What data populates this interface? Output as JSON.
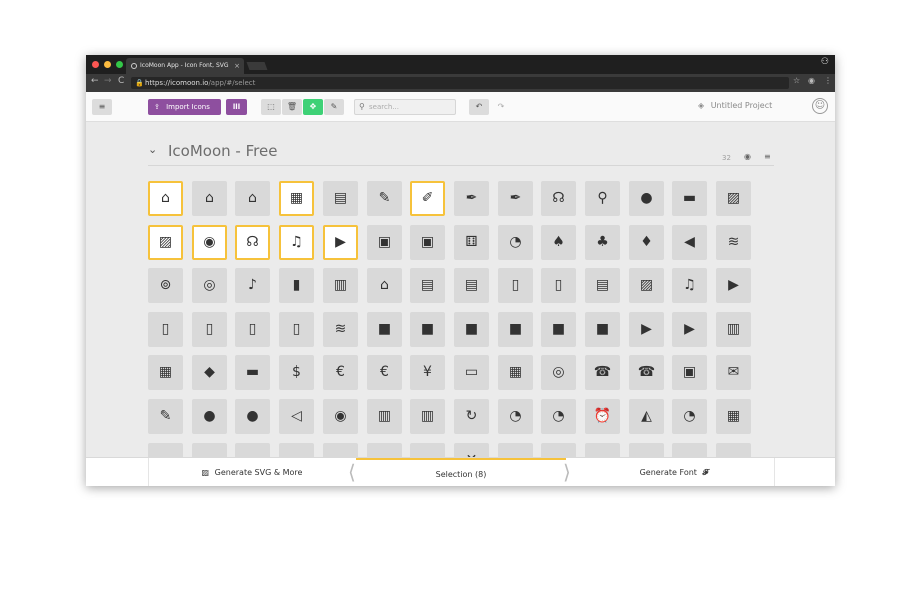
{
  "browser": {
    "tab_title": "IcoMoon App - Icon Font, SVG",
    "tab_close": "×",
    "url_host": "https://icomoon.io",
    "url_path": "/app/#/select",
    "back": "←",
    "forward": "→",
    "reload": "C"
  },
  "toolbar": {
    "menu_icon": "≡",
    "import_label": "Import Icons",
    "import_icon": "⇪",
    "library_icon": "lll",
    "select_icon": "⬚",
    "delete_icon": "🗑",
    "move_icon": "✥",
    "edit_icon": "✎",
    "search_placeholder": "search...",
    "undo_icon": "↶",
    "redo_icon": "↷",
    "project_icon": "◈",
    "project_name": "Untitled Project",
    "smiley": "☺"
  },
  "icon_set": {
    "title": "IcoMoon - Free",
    "count": "32",
    "chevron": "⌄",
    "eye_icon": "◉",
    "menu_icon": "≡"
  },
  "icons": [
    [
      "⌂",
      "⌂",
      "⌂",
      "▦",
      "▤",
      "✎",
      "✐",
      "✒",
      "✒",
      "☊",
      "⚲",
      "●",
      "▬",
      "▨"
    ],
    [
      "▨",
      "◉",
      "☊",
      "♫",
      "▶",
      "▣",
      "▣",
      "⚅",
      "◔",
      "♠",
      "♣",
      "♦",
      "◀",
      "≋"
    ],
    [
      "⊚",
      "◎",
      "♪",
      "▮",
      "▥",
      "⌂",
      "▤",
      "▤",
      "▯",
      "▯",
      "▤",
      "▨",
      "♫",
      "▶"
    ],
    [
      "▯",
      "▯",
      "▯",
      "▯",
      "≋",
      "■",
      "■",
      "■",
      "■",
      "■",
      "■",
      "▶",
      "▶",
      "▥"
    ],
    [
      "▦",
      "◆",
      "▬",
      "$",
      "€",
      "€",
      "¥",
      "▭",
      "▦",
      "◎",
      "☎",
      "☎",
      "▣",
      "✉"
    ],
    [
      "✎",
      "●",
      "●",
      "◁",
      "◉",
      "▥",
      "▥",
      "↻",
      "◔",
      "◔",
      "⏰",
      "◭",
      "◔",
      "▦"
    ],
    [
      "▬",
      "▬",
      "▬",
      "▬",
      "▬",
      "▬",
      "▬",
      "✕",
      "▬",
      "▬",
      "▬",
      "▬",
      "▬",
      "▬"
    ]
  ],
  "footer": {
    "generate_svg": "Generate SVG & More",
    "selection": "Selection (8)",
    "generate_font": "Generate Font",
    "font_icon": "𝓕",
    "svg_icon": "▨"
  },
  "colors": {
    "accent_purple": "#8e4f9f",
    "accent_green": "#3ed176",
    "selection_border": "#f6c23b"
  }
}
